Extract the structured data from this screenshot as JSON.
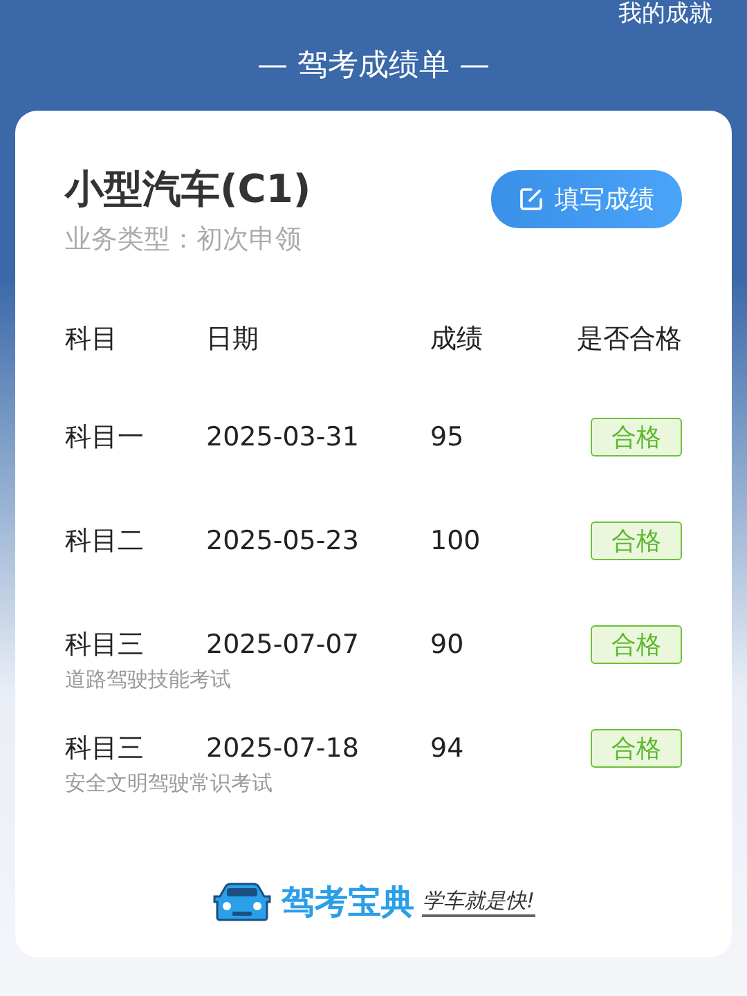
{
  "top_link": "我的成就",
  "title": "— 驾考成绩单 —",
  "license": {
    "name": "小型汽车(C1)",
    "business": "业务类型：初次申领"
  },
  "fill_button": "填写成绩",
  "table": {
    "columns": [
      "科目",
      "日期",
      "成绩",
      "是否合格"
    ],
    "rows": [
      {
        "subject": "科目一",
        "date": "2025-03-31",
        "score": "95",
        "passed": true,
        "result": "合格"
      },
      {
        "subject": "科目二",
        "date": "2025-05-23",
        "score": "100",
        "passed": true,
        "result": "合格"
      },
      {
        "subject": "科目三",
        "note": "道路驾驶技能考试",
        "date": "2025-07-07",
        "score": "90",
        "passed": true,
        "result": "合格"
      },
      {
        "subject": "科目三",
        "note": "安全文明驾驶常识考试",
        "date": "2025-07-18",
        "score": "94",
        "passed": true,
        "result": "合格"
      }
    ]
  },
  "brand": {
    "name": "驾考宝典",
    "slogan": "学车就是快!"
  }
}
